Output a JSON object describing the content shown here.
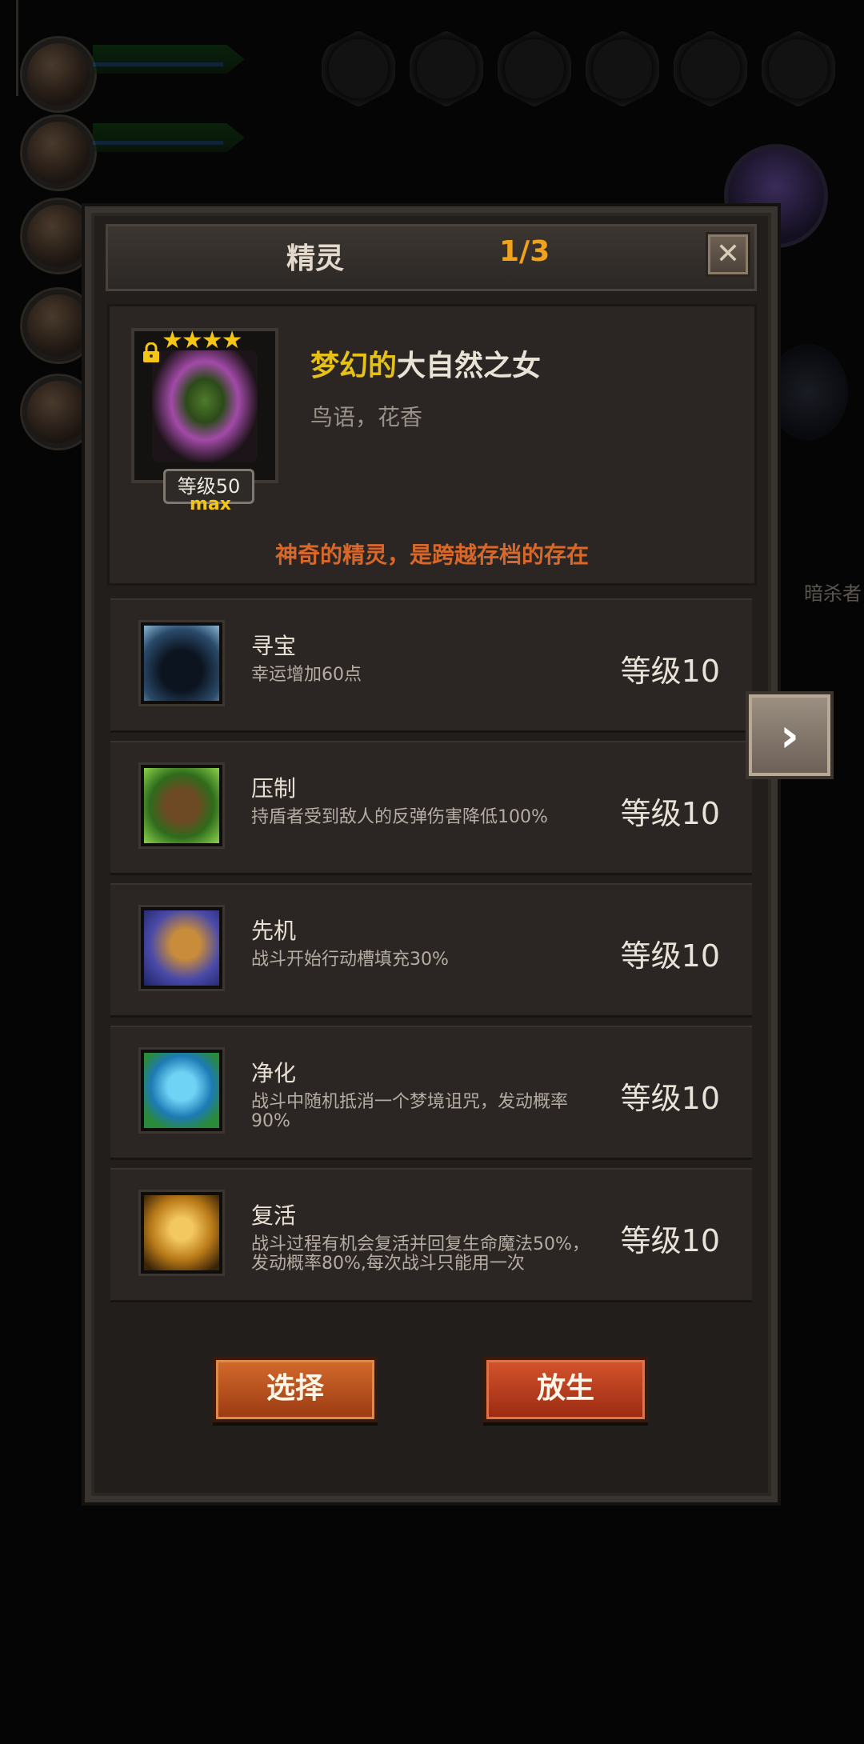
{
  "modal": {
    "title": "精灵",
    "page": "1/3",
    "close_label": "✕"
  },
  "hero": {
    "stars": "★★★★",
    "level": "等级50",
    "max": "max",
    "name_prefix": "梦幻的",
    "name_main": "大自然之女",
    "subtitle": "鸟语，花香",
    "description": "神奇的精灵，是跨越存档的存在"
  },
  "skills": [
    {
      "name": "寻宝",
      "desc": "幸运增加60点",
      "level": "等级10",
      "icon": "treasure-icon"
    },
    {
      "name": "压制",
      "desc": "持盾者受到敌人的反弹伤害降低100%",
      "level": "等级10",
      "icon": "suppress-icon"
    },
    {
      "name": "先机",
      "desc": "战斗开始行动槽填充30%",
      "level": "等级10",
      "icon": "initiative-icon"
    },
    {
      "name": "净化",
      "desc": "战斗中随机抵消一个梦境诅咒，发动概率90%",
      "level": "等级10",
      "icon": "purify-icon"
    },
    {
      "name": "复活",
      "desc": "战斗过程有机会复活并回复生命魔法50%，发动概率80%,每次战斗只能用一次",
      "level": "等级10",
      "icon": "revive-icon"
    }
  ],
  "buttons": {
    "select": "选择",
    "release": "放生",
    "next": "›"
  },
  "background": {
    "right_label": "暗杀者"
  },
  "colors": {
    "accent_orange": "#f0a21c",
    "name_gold": "#e6c119",
    "desc_orange": "#d8672a",
    "button_red": "#b84a1c"
  }
}
